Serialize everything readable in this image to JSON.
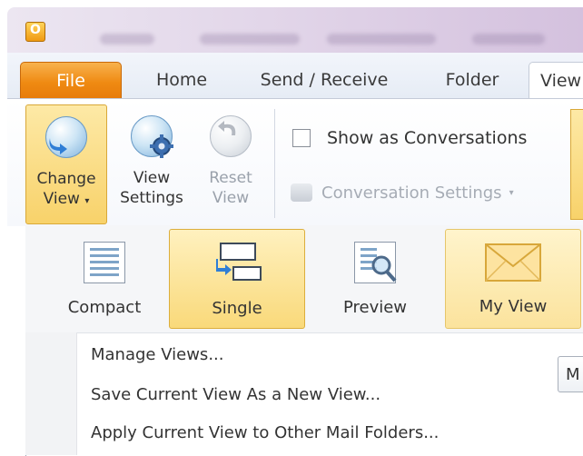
{
  "window": {
    "app_icon_letter": "O"
  },
  "tabs": [
    "File",
    "Home",
    "Send / Receive",
    "Folder",
    "View"
  ],
  "ribbon": {
    "change_view": {
      "line1": "Change",
      "line2": "View"
    },
    "view_settings": {
      "line1": "View",
      "line2": "Settings"
    },
    "reset_view": {
      "line1": "Reset",
      "line2": "View"
    },
    "show_as_conversations": "Show as Conversations",
    "conversation_settings": "Conversation Settings"
  },
  "gallery": {
    "items": [
      {
        "label": "Compact",
        "icon": "compact-view-icon"
      },
      {
        "label": "Single",
        "icon": "single-view-icon",
        "selected": true
      },
      {
        "label": "Preview",
        "icon": "preview-view-icon"
      },
      {
        "label": "My View",
        "icon": "envelope-icon",
        "highlighted": true
      }
    ]
  },
  "menu": {
    "manage_views": "Manage Views...",
    "save_view": "Save Current View As a New View...",
    "apply_view": "Apply Current View to Other Mail Folders..."
  },
  "right_button_partial": "M",
  "colors": {
    "file_tab": "#ef8a12",
    "active_highlight": "#f8d26a"
  }
}
